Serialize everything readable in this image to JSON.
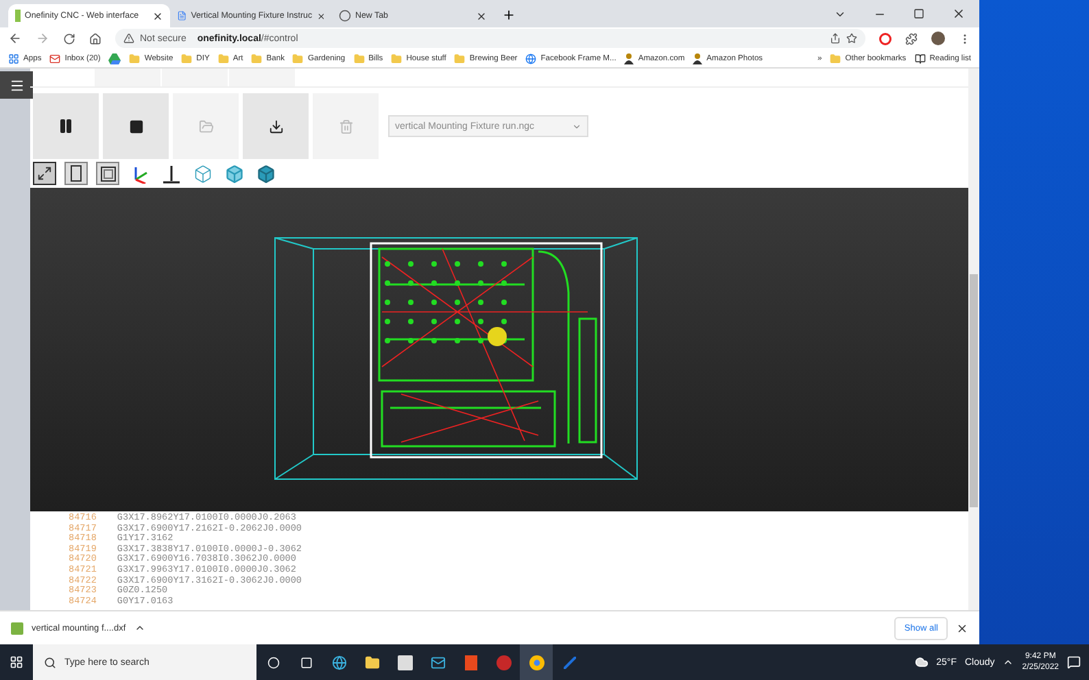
{
  "browser": {
    "tabs": [
      {
        "title": "Onefinity CNC - Web interface",
        "kind": "cnc",
        "selected": true
      },
      {
        "title": "Vertical Mounting Fixture Instruc",
        "kind": "doc",
        "selected": false
      },
      {
        "title": "New Tab",
        "kind": "chrome",
        "selected": false
      }
    ],
    "address": {
      "security": "Not secure",
      "host": "onefinity.local",
      "path": "/#control"
    },
    "bookmarks": [
      {
        "label": "Apps",
        "kind": "apps"
      },
      {
        "label": "Inbox (20)",
        "kind": "mail"
      },
      {
        "kind": "drive"
      },
      {
        "label": "Website",
        "kind": "folder"
      },
      {
        "label": "DIY",
        "kind": "folder"
      },
      {
        "label": "Art",
        "kind": "folder"
      },
      {
        "label": "Bank",
        "kind": "folder"
      },
      {
        "label": "Gardening",
        "kind": "folder"
      },
      {
        "label": "Bills",
        "kind": "folder"
      },
      {
        "label": "House stuff",
        "kind": "folder"
      },
      {
        "label": "Brewing Beer",
        "kind": "folder"
      },
      {
        "label": "Facebook Frame M...",
        "kind": "facebook"
      },
      {
        "label": "Amazon.com",
        "kind": "amazon"
      },
      {
        "label": "Amazon Photos",
        "kind": "amazon"
      }
    ],
    "more_bookmarks": "»",
    "other_bookmarks": "Other bookmarks",
    "reading_list": "Reading list"
  },
  "control": {
    "buttons": [
      {
        "kind": "pause",
        "disabled": false
      },
      {
        "kind": "stop",
        "disabled": false
      },
      {
        "kind": "open",
        "disabled": true
      },
      {
        "kind": "download",
        "disabled": false
      },
      {
        "kind": "delete",
        "disabled": true
      }
    ],
    "file_select": {
      "value": "vertical Mounting Fixture run.ngc",
      "disabled": true
    },
    "view_buttons": [
      {
        "kind": "fit",
        "selected": true
      },
      {
        "kind": "front",
        "selected": false
      },
      {
        "kind": "box",
        "selected": false
      },
      {
        "kind": "axes",
        "selected": false
      },
      {
        "kind": "tool",
        "selected": false
      },
      {
        "kind": "wire",
        "selected": false
      },
      {
        "kind": "shade",
        "selected": false
      },
      {
        "kind": "solid",
        "selected": false
      }
    ]
  },
  "gcode": [
    {
      "line": "84716",
      "code": "G3X17.8962Y17.0100I0.0000J0.2063"
    },
    {
      "line": "84717",
      "code": "G3X17.6900Y17.2162I-0.2062J0.0000"
    },
    {
      "line": "84718",
      "code": "G1Y17.3162"
    },
    {
      "line": "84719",
      "code": "G3X17.3838Y17.0100I0.0000J-0.3062"
    },
    {
      "line": "84720",
      "code": "G3X17.6900Y16.7038I0.3062J0.0000"
    },
    {
      "line": "84721",
      "code": "G3X17.9963Y17.0100I0.0000J0.3062"
    },
    {
      "line": "84722",
      "code": "G3X17.6900Y17.3162I-0.3062J0.0000"
    },
    {
      "line": "84723",
      "code": "G0Z0.1250"
    },
    {
      "line": "84724",
      "code": "G0Y17.0163"
    }
  ],
  "downloads": {
    "file": "vertical mounting f....dxf",
    "show_all": "Show all"
  },
  "taskbar": {
    "search_placeholder": "Type here to search",
    "temperature": "25°F",
    "weather": "Cloudy",
    "time": "9:42 PM",
    "date": "2/25/2022"
  }
}
